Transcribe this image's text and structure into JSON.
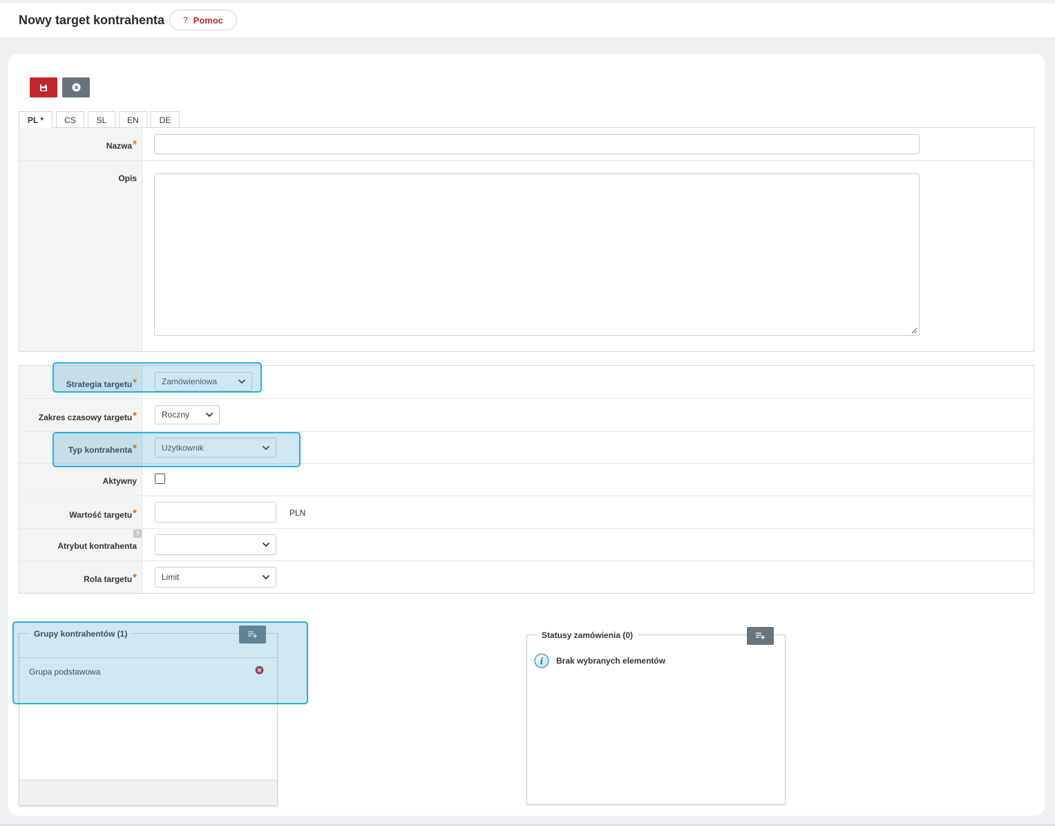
{
  "header": {
    "title": "Nowy target kontrahenta",
    "help_icon": "?",
    "help_label": "Pomoc"
  },
  "toolbar": {
    "save_icon": "save-icon",
    "cancel_icon": "close-circle-icon"
  },
  "tabs": [
    {
      "label": "PL *",
      "active": true
    },
    {
      "label": "CS",
      "active": false
    },
    {
      "label": "SL",
      "active": false
    },
    {
      "label": "EN",
      "active": false
    },
    {
      "label": "DE",
      "active": false
    }
  ],
  "form_basic": {
    "name_label": "Nazwa",
    "name_value": "",
    "description_label": "Opis",
    "description_value": ""
  },
  "form_details": {
    "strategy_label": "Strategia targetu",
    "strategy_value": "Zamówieniowa",
    "range_label": "Zakres czasowy targetu",
    "range_value": "Roczny",
    "type_label": "Typ kontrahenta",
    "type_value": "Użytkownik",
    "active_label": "Aktywny",
    "active_checked": false,
    "value_label": "Wartość targetu",
    "value_value": "",
    "currency": "PLN",
    "attribute_hint": "?",
    "attribute_label": "Atrybut kontrahenta",
    "attribute_value": "",
    "role_label": "Rola targetu",
    "role_value": "Limit",
    "required_mark": "*"
  },
  "groups": {
    "legend": "Grupy kontrahentów (1)",
    "items": [
      "Grupa podstawowa"
    ]
  },
  "statuses": {
    "legend": "Statusy zamówienia (0)",
    "empty_text": "Brak wybranych elementów"
  },
  "colors": {
    "accent_red": "#c0272d",
    "button_gray": "#68757f",
    "highlight": "#26b0e0",
    "required": "#e06a1a"
  }
}
